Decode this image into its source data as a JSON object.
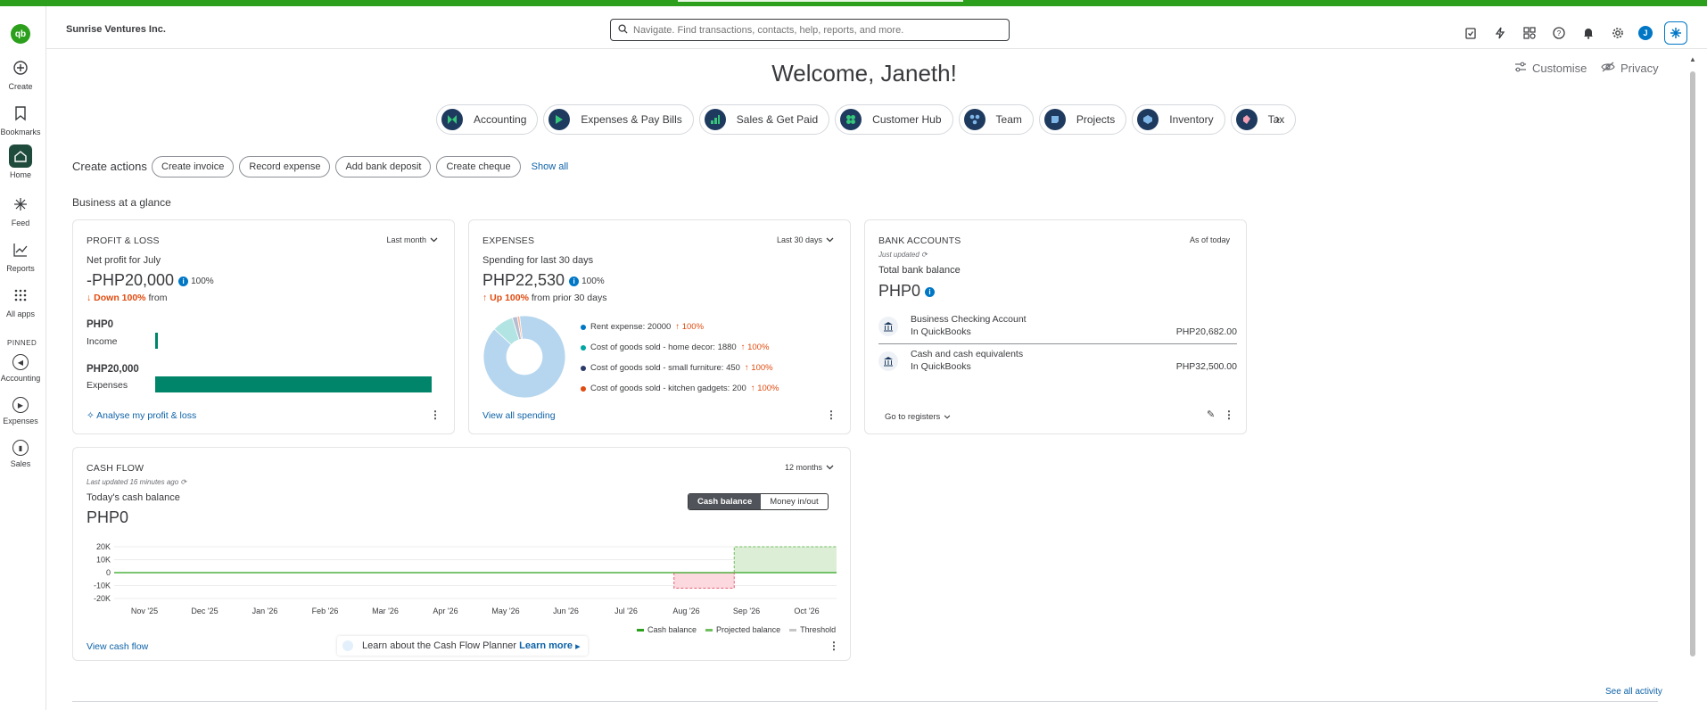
{
  "header": {
    "company": "Sunrise Ventures Inc.",
    "search_placeholder": "Navigate. Find transactions, contacts, help, reports, and more.",
    "avatar_initial": "J"
  },
  "rail": {
    "create": "Create",
    "bookmarks": "Bookmarks",
    "home": "Home",
    "feed": "Feed",
    "reports": "Reports",
    "all_apps": "All apps",
    "pinned": "PINNED",
    "accounting": "Accounting",
    "expenses": "Expenses",
    "sales": "Sales"
  },
  "welcome": "Welcome, Janeth!",
  "customise": "Customise",
  "privacy": "Privacy",
  "tabs": [
    {
      "label": "Accounting",
      "color": "#1e3a5f"
    },
    {
      "label": "Expenses & Pay Bills",
      "color": "#1e3a5f"
    },
    {
      "label": "Sales & Get Paid",
      "color": "#1e3a5f"
    },
    {
      "label": "Customer Hub",
      "color": "#1e3a5f"
    },
    {
      "label": "Team",
      "color": "#1e3a5f"
    },
    {
      "label": "Projects",
      "color": "#1e3a5f"
    },
    {
      "label": "Inventory",
      "color": "#1e3a5f"
    },
    {
      "label": "Tax",
      "color": "#1e3a5f"
    }
  ],
  "create_actions": {
    "label": "Create actions",
    "buttons": [
      "Create invoice",
      "Record expense",
      "Add bank deposit",
      "Create cheque"
    ],
    "show_all": "Show all"
  },
  "glance_title": "Business at a glance",
  "profit_loss": {
    "title": "PROFIT & LOSS",
    "range": "Last month",
    "net_label": "Net profit for July",
    "net_amount": "-PHP20,000",
    "pct": "100%",
    "delta_dir": "Down 100%",
    "delta_suffix": "from",
    "income_amount": "PHP0",
    "income_label": "Income",
    "income_fraction": 0.0,
    "expenses_amount": "PHP20,000",
    "expenses_label": "Expenses",
    "expenses_fraction": 1.0,
    "link": "Analyse my profit & loss"
  },
  "expenses": {
    "title": "EXPENSES",
    "range": "Last 30 days",
    "spending_label": "Spending for last 30 days",
    "amount": "PHP22,530",
    "pct": "100%",
    "delta_dir": "Up 100%",
    "delta_suffix": "from prior 30 days",
    "items": [
      {
        "label": "Rent expense: 20000",
        "value": 20000,
        "pct": "100%",
        "color": "#0077c5",
        "slice_color": "#b5d6ee"
      },
      {
        "label": "Cost of goods sold - home decor: 1880",
        "value": 1880,
        "pct": "100%",
        "color": "#00a6a4",
        "slice_color": "#b2e4e3"
      },
      {
        "label": "Cost of goods sold - small furniture: 450",
        "value": 450,
        "pct": "100%",
        "color": "#2b3a6b",
        "slice_color": "#b7bdd1"
      },
      {
        "label": "Cost of goods sold - kitchen gadgets: 200",
        "value": 200,
        "pct": "100%",
        "color": "#e04b0f",
        "slice_color": "#f5b59c"
      }
    ],
    "link": "View all spending"
  },
  "bank": {
    "title": "BANK ACCOUNTS",
    "range": "As of today",
    "updated": "Just updated",
    "total_label": "Total bank balance",
    "total": "PHP0",
    "accounts": [
      {
        "name": "Business Checking Account",
        "source": "In QuickBooks",
        "amount": "PHP20,682.00"
      },
      {
        "name": "Cash and cash equivalents",
        "source": "In QuickBooks",
        "amount": "PHP32,500.00"
      }
    ],
    "link": "Go to registers"
  },
  "cashflow": {
    "title": "CASH FLOW",
    "range": "12 months",
    "updated": "Last updated 16 minutes ago",
    "today_label": "Today's cash balance",
    "today_amount": "PHP0",
    "seg_on": "Cash balance",
    "seg_off": "Money in/out",
    "legend": [
      "Cash balance",
      "Projected balance",
      "Threshold"
    ],
    "link": "View cash flow",
    "learn_text": "Learn about the Cash Flow Planner",
    "learn_link": "Learn more"
  },
  "see_all": "See all activity",
  "chart_data": {
    "type": "line",
    "x": [
      "Nov '25",
      "Dec '25",
      "Jan '26",
      "Feb '26",
      "Mar '26",
      "Apr '26",
      "May '26",
      "Jun '26",
      "Jul '26",
      "Aug '26",
      "Sep '26",
      "Oct '26"
    ],
    "ytick_labels": [
      "20K",
      "10K",
      "0",
      "-10K",
      "-20K"
    ],
    "yticks": [
      20000,
      10000,
      0,
      -10000,
      -20000
    ],
    "ylim": [
      -20000,
      20000
    ],
    "series": [
      {
        "name": "Cash balance",
        "segments": [
          [
            0,
            0
          ],
          [
            9.5,
            0
          ]
        ]
      },
      {
        "name": "Projected balance",
        "segments": [
          [
            9.3,
            0
          ],
          [
            9.3,
            -12000
          ],
          [
            10.3,
            -12000
          ],
          [
            10.3,
            20000
          ],
          [
            12,
            20000
          ]
        ]
      }
    ],
    "colors": {
      "cash": "#2ca01c",
      "projected_neg": "#e85d75",
      "projected_pos": "#6fbf5f",
      "threshold": "#c6c6c6"
    }
  }
}
